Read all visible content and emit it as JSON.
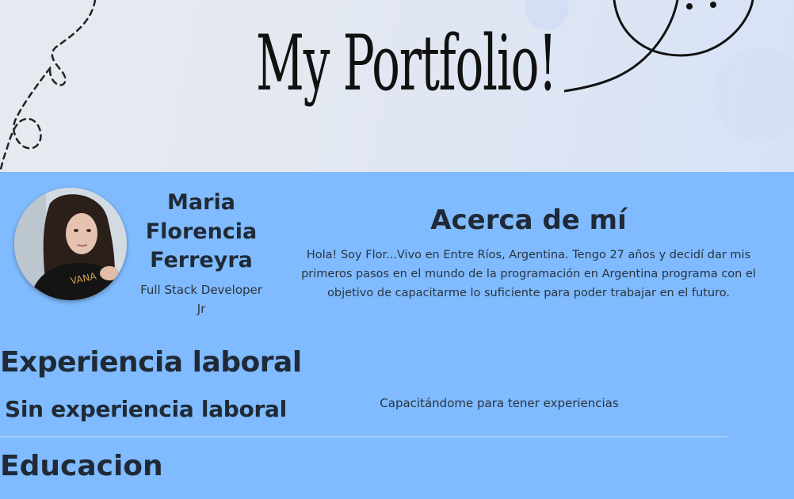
{
  "banner": {
    "title": "My Portfolio!"
  },
  "profile": {
    "name": "Maria Florencia Ferreyra",
    "role": "Full Stack Developer Jr"
  },
  "about": {
    "title": "Acerca de mí",
    "text": "Hola! Soy Flor...Vivo en Entre Ríos, Argentina. Tengo 27 años y decidí dar mis primeros pasos en el mundo de la programación en Argentina programa con el objetivo de capacitarme lo suficiente para poder trabajar en el futuro."
  },
  "experience": {
    "title": "Experiencia laboral",
    "item_title": "Sin experiencia laboral",
    "item_note": "Capacitándome para tener experiencias"
  },
  "education": {
    "title": "Educacion"
  },
  "colors": {
    "page_background": "#80bbff",
    "text": "#1f2a36"
  }
}
